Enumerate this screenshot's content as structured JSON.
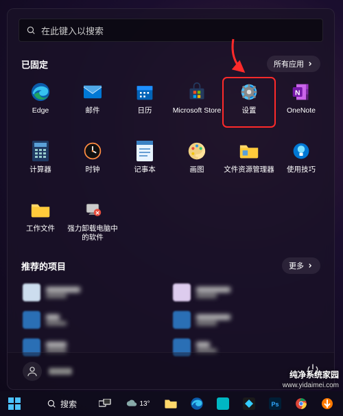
{
  "search": {
    "placeholder": "在此键入以搜索"
  },
  "pinned": {
    "title": "已固定",
    "all_apps_label": "所有应用",
    "tiles": [
      {
        "name": "edge",
        "label": "Edge"
      },
      {
        "name": "mail",
        "label": "邮件"
      },
      {
        "name": "calendar",
        "label": "日历"
      },
      {
        "name": "store",
        "label": "Microsoft Store"
      },
      {
        "name": "settings",
        "label": "设置"
      },
      {
        "name": "onenote",
        "label": "OneNote"
      },
      {
        "name": "calculator",
        "label": "计算器"
      },
      {
        "name": "clock",
        "label": "时钟"
      },
      {
        "name": "notepad",
        "label": "记事本"
      },
      {
        "name": "paint",
        "label": "画图"
      },
      {
        "name": "explorer",
        "label": "文件资源管理器"
      },
      {
        "name": "tips",
        "label": "使用技巧"
      },
      {
        "name": "work-folder",
        "label": "工作文件"
      },
      {
        "name": "uninstall",
        "label": "强力卸载电脑中的软件"
      }
    ]
  },
  "recommended": {
    "title": "推荐的项目",
    "more_label": "更多"
  },
  "taskbar": {
    "search_label": "搜索",
    "weather_temp": "13°"
  },
  "watermark": {
    "line1": "纯净系统家园",
    "line2": "www.yidaimei.com"
  }
}
